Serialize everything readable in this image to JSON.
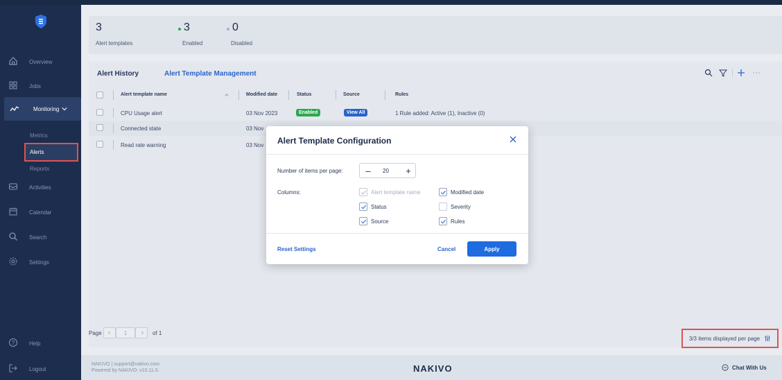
{
  "sidebar": {
    "items": [
      {
        "label": "Overview",
        "icon": "home-icon"
      },
      {
        "label": "Jobs",
        "icon": "grid-icon"
      },
      {
        "label": "Monitoring",
        "icon": "pulse-icon"
      },
      {
        "label": "Activities",
        "icon": "inbox-icon"
      },
      {
        "label": "Calendar",
        "icon": "calendar-icon"
      },
      {
        "label": "Search",
        "icon": "search-icon"
      },
      {
        "label": "Settings",
        "icon": "gear-icon"
      }
    ],
    "monitoring_sub": [
      "Metrics",
      "Alerts",
      "Reports"
    ],
    "help_label": "Help",
    "logout_label": "Logout"
  },
  "stats": {
    "total_num": "3",
    "total_label": "Alert templates",
    "enabled_num": "3",
    "enabled_label": "Enabled",
    "disabled_num": "0",
    "disabled_label": "Disabled"
  },
  "tabs": {
    "history": "Alert History",
    "management": "Alert Template Management"
  },
  "table": {
    "headers": {
      "name": "Alert template name",
      "modified": "Modified date",
      "status": "Status",
      "source": "Source",
      "rules": "Rules"
    },
    "rows": [
      {
        "name": "CPU Usage alert",
        "modified": "03 Nov 2023",
        "status": "Enabled",
        "source": "View All",
        "rules": "1 Rule added: Active (1), Inactive (0)"
      },
      {
        "name": "Connected state",
        "modified": "03 Nov"
      },
      {
        "name": "Read rate warning",
        "modified": "03 Nov"
      }
    ]
  },
  "pager": {
    "page_label": "Page",
    "page_value": "1",
    "of_label": "of 1"
  },
  "items_per_page_label": "3/3 items displayed per page",
  "footer": {
    "line1": "NAKIVO | support@nakivo.com",
    "line2": "Powered by NAKIVO: v10.11.0.",
    "brand": "NAKIVO",
    "chat": "Chat With Us"
  },
  "modal": {
    "title": "Alert Template Configuration",
    "items_per_page_label": "Number of items per page:",
    "items_per_page_value": "20",
    "columns_label": "Columns:",
    "columns": [
      {
        "label": "Alert template name",
        "checked": true,
        "disabled": true
      },
      {
        "label": "Modified date",
        "checked": true,
        "disabled": false
      },
      {
        "label": "Status",
        "checked": true,
        "disabled": false
      },
      {
        "label": "Severity",
        "checked": false,
        "disabled": false
      },
      {
        "label": "Source",
        "checked": true,
        "disabled": false
      },
      {
        "label": "Rules",
        "checked": true,
        "disabled": false
      }
    ],
    "reset_label": "Reset Settings",
    "cancel_label": "Cancel",
    "apply_label": "Apply"
  },
  "colors": {
    "accent": "#1f6be0",
    "enabled_badge": "#2ea84f",
    "source_badge": "#2b63c9",
    "highlight": "#e05252"
  }
}
